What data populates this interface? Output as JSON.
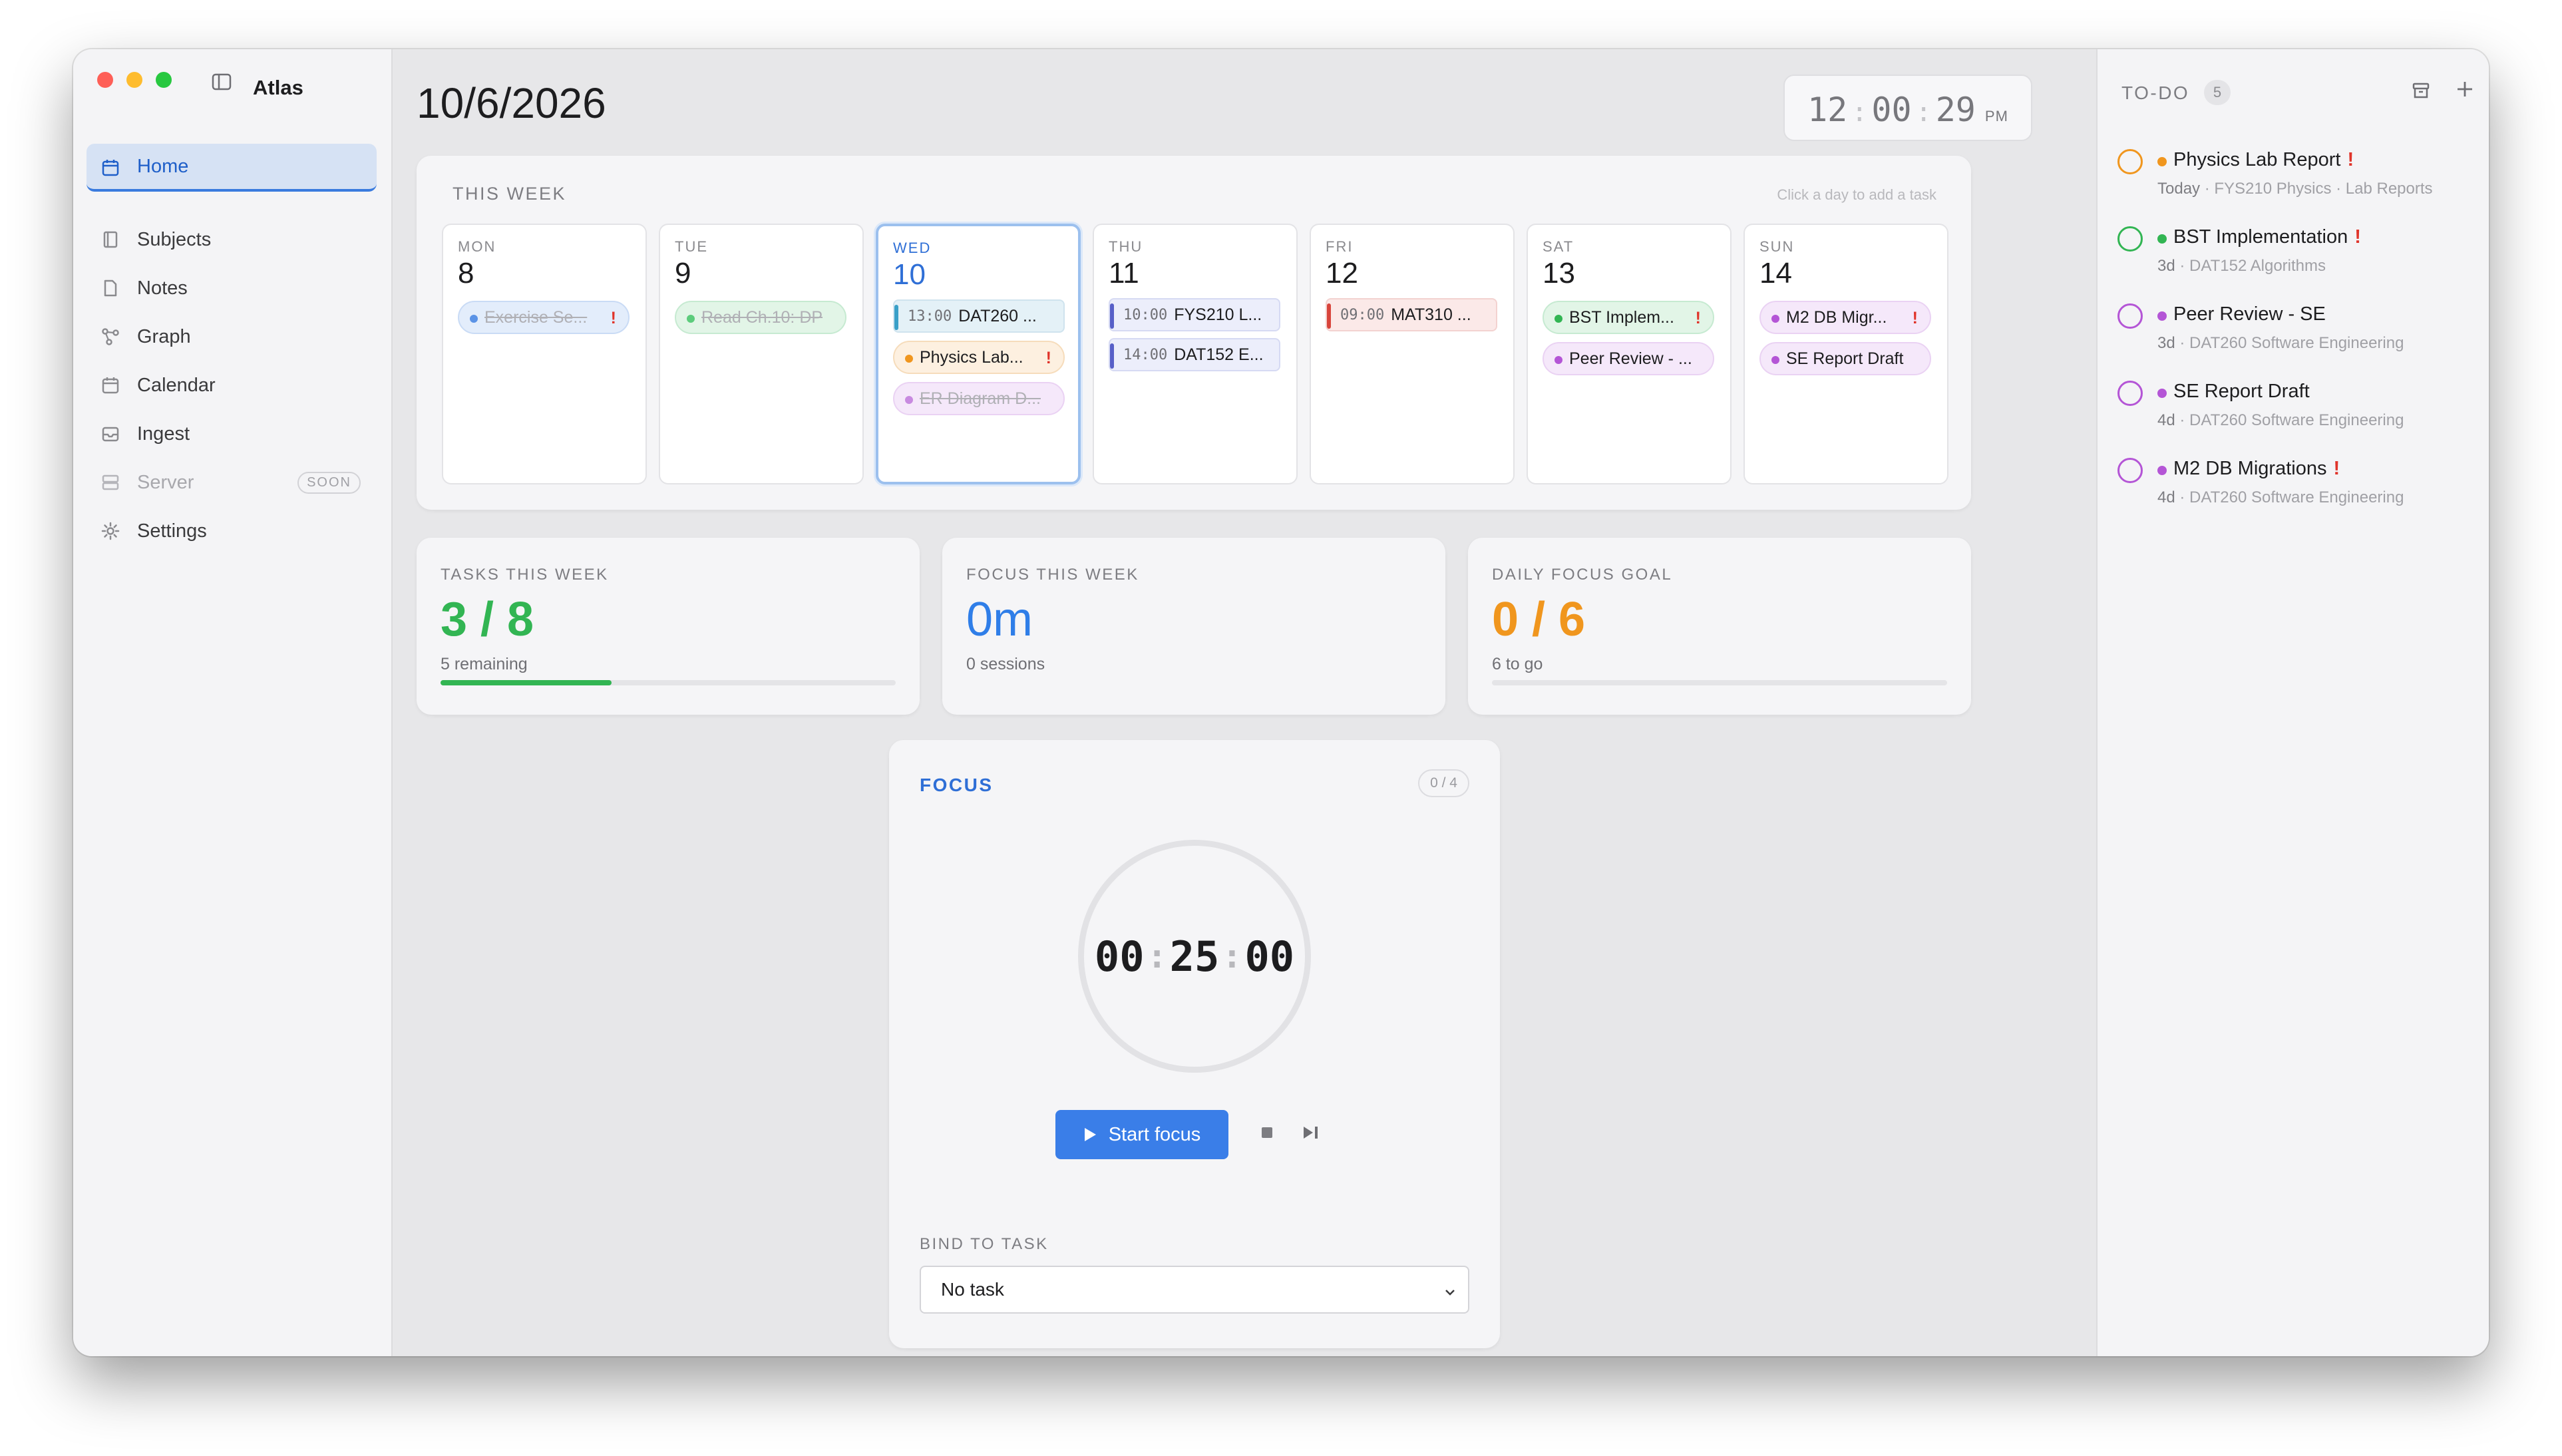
{
  "app": {
    "name": "Atlas"
  },
  "sidebar": {
    "items": [
      {
        "label": "Home"
      },
      {
        "label": "Subjects"
      },
      {
        "label": "Notes"
      },
      {
        "label": "Graph"
      },
      {
        "label": "Calendar"
      },
      {
        "label": "Ingest"
      },
      {
        "label": "Server",
        "badge": "SOON"
      },
      {
        "label": "Settings"
      }
    ]
  },
  "header": {
    "date": "10/6/2026",
    "clock": {
      "hours": "12",
      "minutes": "00",
      "seconds": "29",
      "ampm": "PM"
    }
  },
  "week": {
    "title": "THIS WEEK",
    "hint": "Click a day to add a task",
    "days": [
      {
        "name": "MON",
        "num": "8",
        "items": [
          "Exercise Se..."
        ]
      },
      {
        "name": "TUE",
        "num": "9",
        "items": [
          "Read Ch.10: DP"
        ]
      },
      {
        "name": "WED",
        "num": "10",
        "items": [
          "13:00",
          "DAT260 ...",
          "Physics Lab...",
          "ER Diagram D..."
        ]
      },
      {
        "name": "THU",
        "num": "11",
        "items": [
          "10:00",
          "FYS210 L...",
          "14:00",
          "DAT152 E..."
        ]
      },
      {
        "name": "FRI",
        "num": "12",
        "items": [
          "09:00",
          "MAT310 ..."
        ]
      },
      {
        "name": "SAT",
        "num": "13",
        "items": [
          "BST Implem...",
          "Peer Review - ..."
        ]
      },
      {
        "name": "SUN",
        "num": "14",
        "items": [
          "M2 DB Migr...",
          "SE Report Draft"
        ]
      }
    ]
  },
  "stats": {
    "tasks": {
      "label": "TASKS THIS WEEK",
      "value": "3 / 8",
      "sub": "5 remaining",
      "progress": 0.375
    },
    "focus": {
      "label": "FOCUS THIS WEEK",
      "value": "0m",
      "sub": "0 sessions"
    },
    "goal": {
      "label": "DAILY FOCUS GOAL",
      "value": "0 / 6",
      "sub": "6 to go",
      "progress": 0
    }
  },
  "focus": {
    "title": "FOCUS",
    "counter": "0 / 4",
    "timer": {
      "h": "00",
      "m": "25",
      "s": "00"
    },
    "start_label": "Start focus",
    "bind_label": "BIND TO TASK",
    "select_value": "No task"
  },
  "todo": {
    "title": "TO-DO",
    "count": "5",
    "items": [
      {
        "title": "Physics Lab Report",
        "due": "Today",
        "meta": "FYS210 Physics · Lab Reports",
        "color": "#f0961e"
      },
      {
        "title": "BST Implementation",
        "due": "3d",
        "meta": "DAT152 Algorithms",
        "color": "#32b553"
      },
      {
        "title": "Peer Review - SE",
        "due": "3d",
        "meta": "DAT260 Software Engineering",
        "color": "#b455d6"
      },
      {
        "title": "SE Report Draft",
        "due": "4d",
        "meta": "DAT260 Software Engineering",
        "color": "#b455d6"
      },
      {
        "title": "M2 DB Migrations",
        "due": "4d",
        "meta": "DAT260 Software Engineering",
        "color": "#b455d6"
      }
    ]
  },
  "colors": {
    "accent": "#2f6fd6",
    "green": "#32b553",
    "orange": "#f0961e",
    "purple": "#b455d6",
    "red": "#e0342a"
  }
}
